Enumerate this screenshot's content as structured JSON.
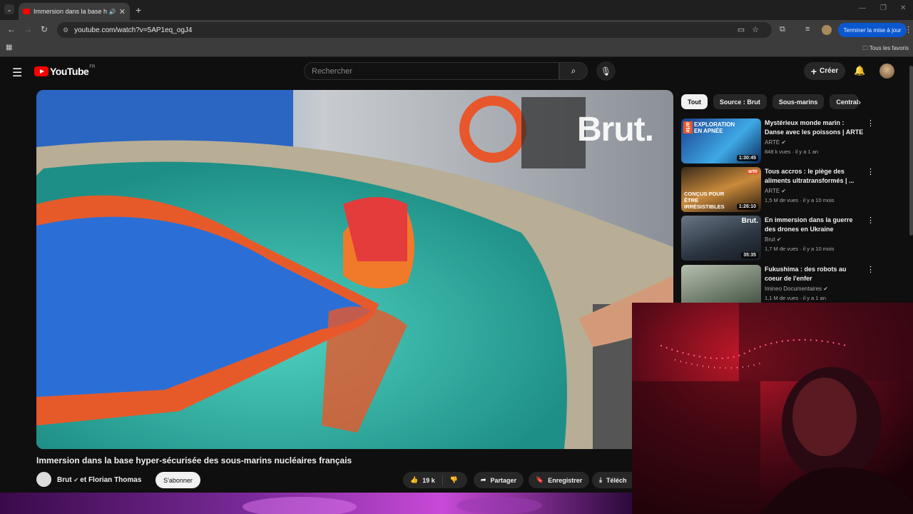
{
  "browser": {
    "tab_title": "Immersion dans la base hyp",
    "url": "youtube.com/watch?v=5AP1eq_ogJ4",
    "update_button": "Terminer la mise à jour",
    "bookmarks_all": "Tous les favoris"
  },
  "youtube": {
    "logo": "YouTube",
    "country": "FR",
    "search_placeholder": "Rechercher",
    "create_label": "Créer"
  },
  "video": {
    "overlay_logo": "Brut.",
    "title": "Immersion dans la base hyper-sécurisée des sous-marins nucléaires français",
    "channel": "Brut",
    "collaborator": "et Florian Thomas",
    "subscribe_label": "S'abonner",
    "likes": "19 k",
    "share_label": "Partager",
    "save_label": "Enregistrer",
    "download_label": "Téléch"
  },
  "filters": [
    "Tout",
    "Source : Brut",
    "Sous-marins",
    "Centrale"
  ],
  "recommendations": [
    {
      "title": "Mystérieux monde marin : Danse avec les poissons | ARTE",
      "channel": "ARTE",
      "meta": "848 k vues · il y a 1 an",
      "duration": "1:30:45",
      "thumb_text": "EXPLORATION EN APNÉE",
      "thumb_badge": "arte"
    },
    {
      "title": "Tous accros : le piège des aliments ultratransformés | ...",
      "channel": "ARTE",
      "meta": "1,5 M de vues · il y a 10 mois",
      "duration": "1:26:10",
      "thumb_text": "CONÇUS POUR ÊTRE IRRÉSISTIBLES",
      "thumb_badge": "arte"
    },
    {
      "title": "En immersion dans la guerre des drones en Ukraine",
      "channel": "Brut",
      "meta": "1,7 M de vues · il y a 10 mois",
      "duration": "35:35",
      "thumb_text": "",
      "thumb_badge": "Brut."
    },
    {
      "title": "Fukushima : des robots au coeur de l'enfer",
      "channel": "Imineo Documentaires",
      "meta": "1,1 M de vues · il y a 1 an",
      "duration": "",
      "thumb_text": "",
      "thumb_badge": ""
    }
  ]
}
